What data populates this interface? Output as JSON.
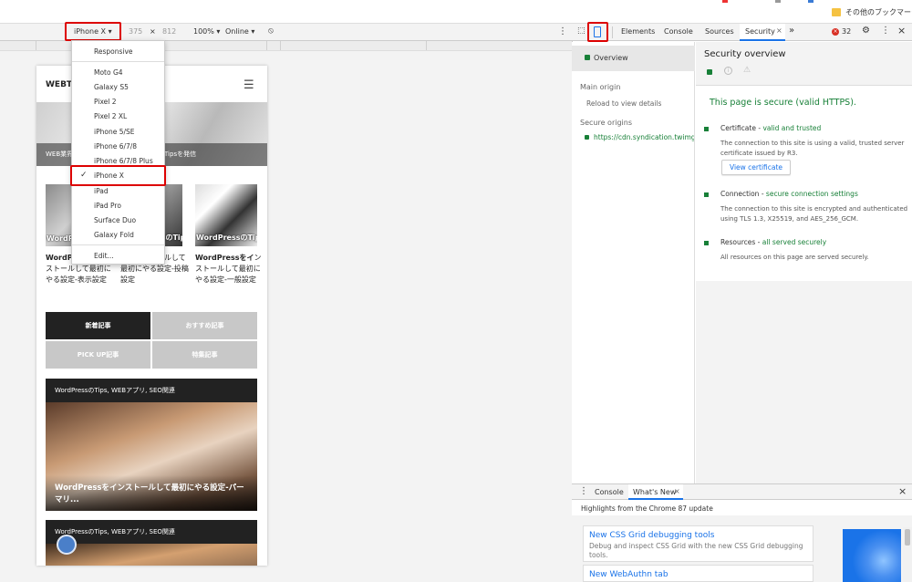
{
  "bookmarks": {
    "other_bookmarks": "その他のブックマーク"
  },
  "device_toolbar": {
    "device": "iPhone X",
    "width": "375",
    "times": "×",
    "height": "812",
    "zoom": "100%",
    "network": "Online"
  },
  "device_menu": {
    "items": [
      "Responsive",
      "Moto G4",
      "Galaxy S5",
      "Pixel 2",
      "Pixel 2 XL",
      "iPhone 5/SE",
      "iPhone 6/7/8",
      "iPhone 6/7/8 Plus",
      "iPhone X",
      "iPad",
      "iPad Pro",
      "Surface Duo",
      "Galaxy Fold",
      "Edit..."
    ],
    "selected": "iPhone X"
  },
  "page": {
    "logo": "WEBT",
    "hero_left": "WEB業界",
    "hero_right": "Tipsを発信",
    "thumbs": [
      {
        "cap": "WordP",
        "title_bold": "WordPressをイ",
        "title_rest": "ンストールして最初にやる設定-表示設定"
      },
      {
        "cap": "WordPressのTips",
        "title_bold": "をイ",
        "title_rest": "ンストールして最初にやる設定-投稿設定"
      },
      {
        "cap": "WordPressのTips",
        "title_bold": "WordPressをイ",
        "title_rest": "ンストールして最初にやる設定-一般設定"
      }
    ],
    "tabs": [
      "新着記事",
      "おすすめ記事",
      "PICK UP記事",
      "特集記事"
    ],
    "section1": "WordPressのTips, WEBアプリ, SEO関連",
    "article_title": "WordPressをインストールして最初にやる設定-パーマリ...",
    "section2": "WordPressのTips, WEBアプリ, SEO関連"
  },
  "devtools": {
    "tabs": [
      "Elements",
      "Console",
      "Sources",
      "Security"
    ],
    "active_tab": "Security",
    "more": "»",
    "error_count": "32",
    "sidebar": {
      "overview": "Overview",
      "main_origin": "Main origin",
      "reload": "Reload to view details",
      "secure_origins": "Secure origins",
      "origin": "https://cdn.syndication.twimg.c"
    },
    "summary_title": "Security overview",
    "secure_msg": "This page is secure (valid HTTPS).",
    "certificate": {
      "label": "Certificate - ",
      "status": "valid and trusted",
      "desc": "The connection to this site is using a valid, trusted server certificate issued by R3.",
      "button": "View certificate"
    },
    "connection": {
      "label": "Connection - ",
      "status": "secure connection settings",
      "desc": "The connection to this site is encrypted and authenticated using TLS 1.3, X25519, and AES_256_GCM."
    },
    "resources": {
      "label": "Resources - ",
      "status": "all served securely",
      "desc": "All resources on this page are served securely."
    }
  },
  "drawer": {
    "tabs": [
      "Console",
      "What's New"
    ],
    "highlights": "Highlights from the Chrome 87 update",
    "card1_title": "New CSS Grid debugging tools",
    "card1_desc": "Debug and inspect CSS Grid with the new CSS Grid debugging tools.",
    "card2_title": "New WebAuthn tab"
  },
  "colors": {
    "accent_red": "#dd0000",
    "secure_green": "#188038",
    "link_blue": "#1a73e8"
  }
}
